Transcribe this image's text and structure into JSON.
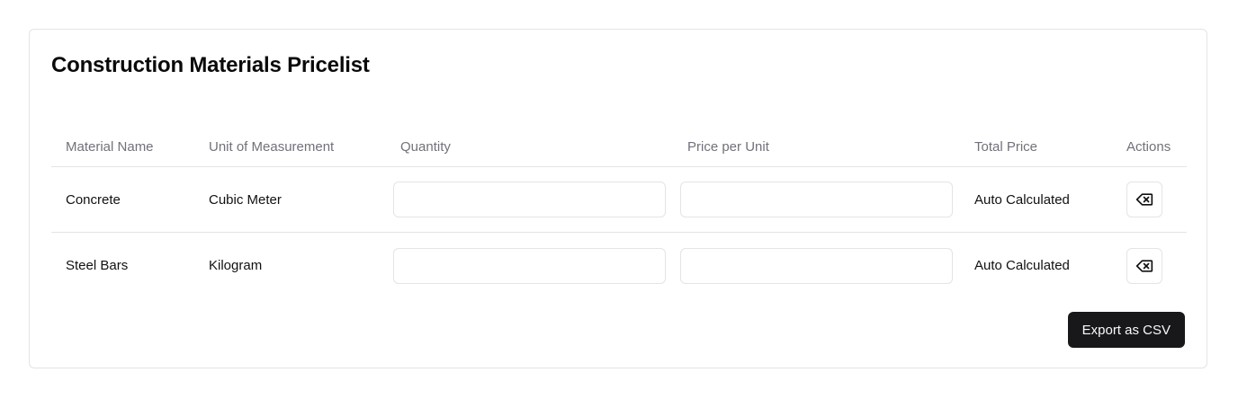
{
  "card": {
    "title": "Construction Materials Pricelist"
  },
  "table": {
    "headers": {
      "material_name": "Material Name",
      "unit": "Unit of Measurement",
      "quantity": "Quantity",
      "price_per_unit": "Price per Unit",
      "total_price": "Total Price",
      "actions": "Actions"
    },
    "rows": [
      {
        "material_name": "Concrete",
        "unit": "Cubic Meter",
        "quantity_value": "",
        "price_value": "",
        "total_price": "Auto Calculated",
        "action_icon": "delete-backspace-icon"
      },
      {
        "material_name": "Steel Bars",
        "unit": "Kilogram",
        "quantity_value": "",
        "price_value": "",
        "total_price": "Auto Calculated",
        "action_icon": "delete-backspace-icon"
      }
    ]
  },
  "footer": {
    "export_label": "Export as CSV"
  },
  "colors": {
    "border": "#e4e4e7",
    "header_text": "#71717a",
    "primary_button": "#18181b",
    "primary_button_text": "#fafafa"
  }
}
